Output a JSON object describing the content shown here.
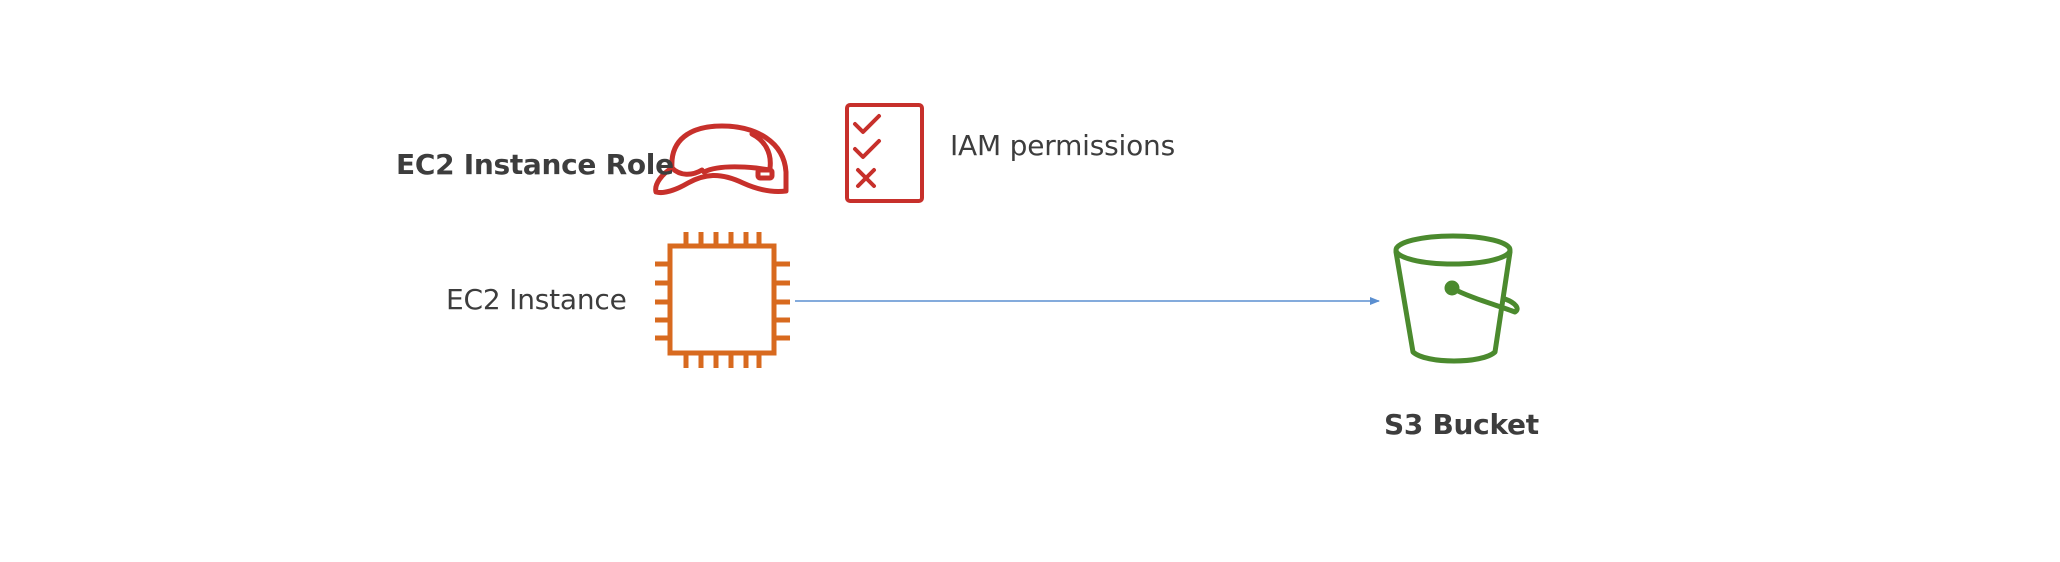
{
  "diagram": {
    "role_label": "EC2 Instance Role",
    "instance_label": "EC2 Instance",
    "permissions_label": "IAM permissions",
    "bucket_label": "S3 Bucket",
    "connections": [
      {
        "from": "ec2-instance",
        "to": "s3-bucket",
        "style": "arrow"
      }
    ]
  },
  "colors": {
    "role_icon": "#c7302b",
    "permissions_icon": "#c7302b",
    "instance_icon": "#d86a1f",
    "bucket_icon": "#4b8a2e",
    "arrow": "#5b8fd0",
    "text": "#3d3d3d"
  },
  "icons": {
    "role": "hard-hat-icon",
    "permissions": "checklist-icon",
    "instance": "chip-icon",
    "bucket": "bucket-icon"
  }
}
